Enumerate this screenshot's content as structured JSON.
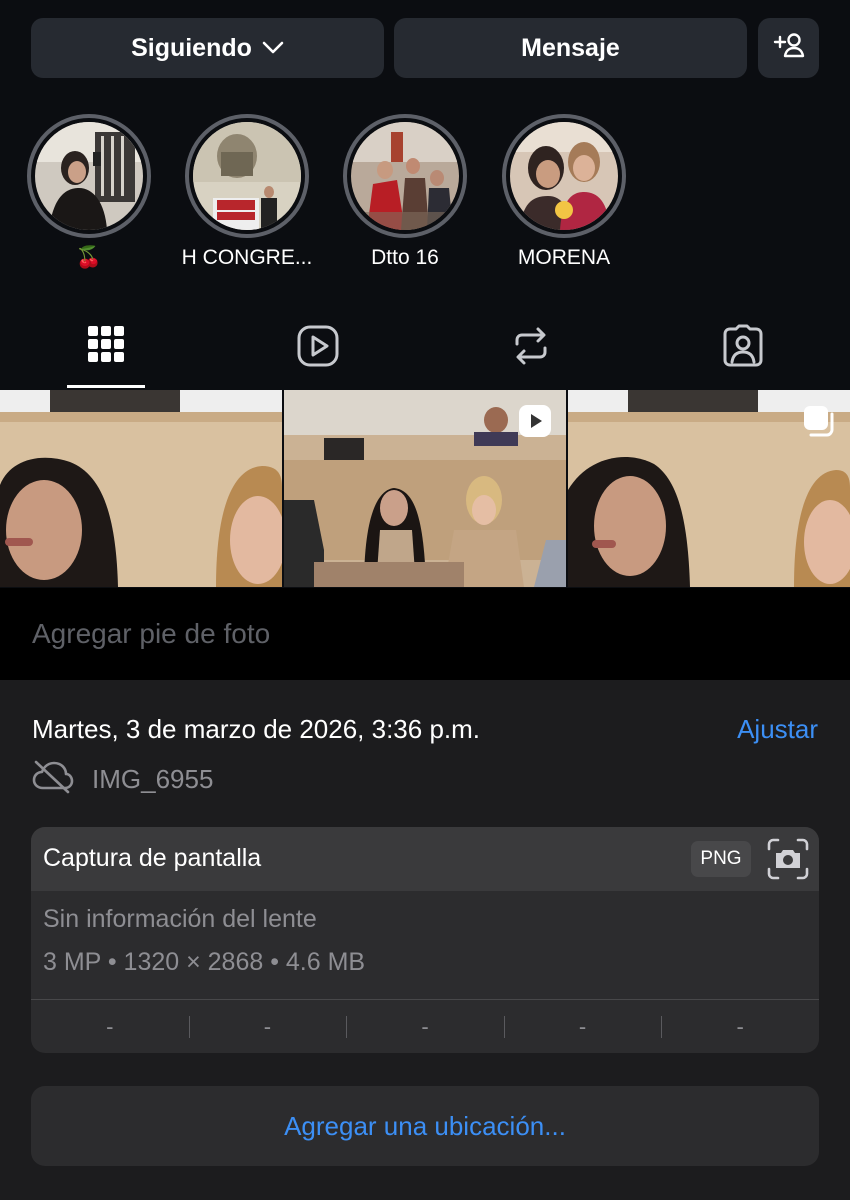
{
  "profile": {
    "follow_button": "Siguiendo",
    "message_button": "Mensaje",
    "highlights": [
      {
        "label": "🍒"
      },
      {
        "label": "H CONGRE..."
      },
      {
        "label": "Dtto 16"
      },
      {
        "label": "MORENA"
      }
    ],
    "tabs": [
      "grid-icon",
      "reels-icon",
      "reposts-icon",
      "tagged-icon"
    ]
  },
  "photo_info": {
    "caption_placeholder": "Agregar pie de foto",
    "date": "Martes, 3 de marzo de 2026, 3:36 p.m.",
    "adjust_label": "Ajustar",
    "filename": "IMG_6955",
    "card": {
      "title": "Captura de pantalla",
      "format_badge": "PNG",
      "lens": "Sin información del lente",
      "meta": "3 MP • 1320 × 2868 • 4.6 MB",
      "exif": [
        "-",
        "-",
        "-",
        "-",
        "-"
      ]
    },
    "location_button": "Agregar una ubicación..."
  },
  "colors": {
    "accent_blue": "#3c8ff5",
    "sheet_bg": "#1c1c1e",
    "card_bg": "#2c2c2e"
  }
}
